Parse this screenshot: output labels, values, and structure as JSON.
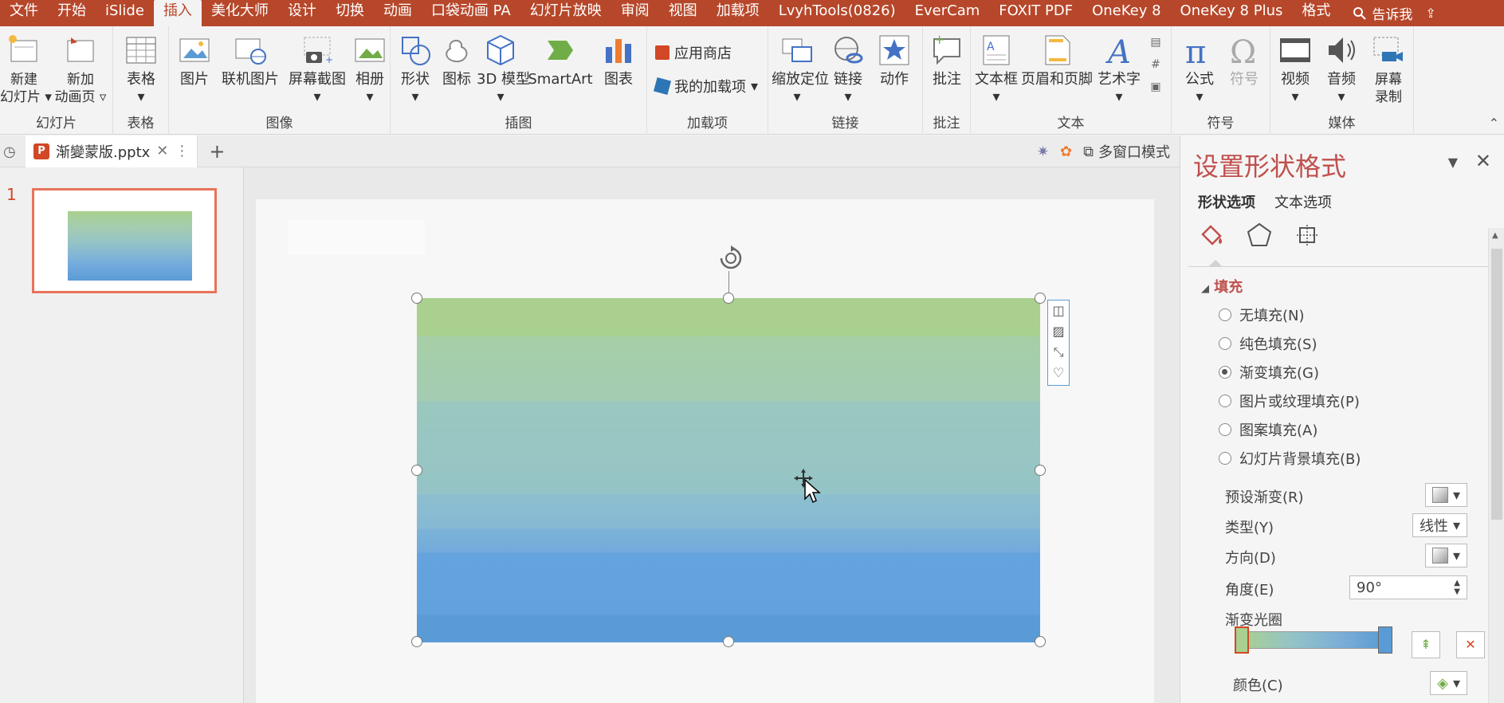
{
  "menu": {
    "tabs": [
      "文件",
      "开始",
      "iSlide",
      "插入",
      "美化大师",
      "设计",
      "切换",
      "动画",
      "口袋动画 PA",
      "幻灯片放映",
      "审阅",
      "视图",
      "加载项",
      "LvyhTools(0826)",
      "EverCam",
      "FOXIT PDF",
      "OneKey 8",
      "OneKey 8 Plus",
      "格式"
    ],
    "active_index": 3,
    "tell_me": "告诉我"
  },
  "ribbon": {
    "slides_group": {
      "label": "幻灯片",
      "new_slide": "新建\n幻灯片",
      "new_anim": "新加\n动画页"
    },
    "table_group": {
      "label": "表格",
      "table": "表格"
    },
    "image_group": {
      "label": "图像",
      "picture": "图片",
      "online_picture": "联机图片",
      "screenshot": "屏幕截图",
      "album": "相册"
    },
    "illust_group": {
      "label": "插图",
      "shapes": "形状",
      "icons": "图标",
      "model3d": "3D 模型",
      "smartart": "SmartArt",
      "chart": "图表"
    },
    "addins_group": {
      "label": "加载项",
      "store": "应用商店",
      "my_addins": "我的加载项"
    },
    "links_group": {
      "label": "链接",
      "zoom": "缩放定位",
      "link": "链接",
      "action": "动作"
    },
    "comments_group": {
      "label": "批注",
      "comment": "批注"
    },
    "text_group": {
      "label": "文本",
      "textbox": "文本框",
      "header_footer": "页眉和页脚",
      "wordart": "艺术字"
    },
    "symbols_group": {
      "label": "符号",
      "equation": "公式",
      "symbol": "符号"
    },
    "media_group": {
      "label": "媒体",
      "video": "视频",
      "audio": "音频",
      "record": "屏幕\n录制"
    }
  },
  "tabbar": {
    "doc_name": "渐變蒙版.pptx",
    "multi_window": "多窗口模式"
  },
  "thumbs": {
    "slide_number": "1"
  },
  "pane": {
    "title": "设置形状格式",
    "tab_shape": "形状选项",
    "tab_text": "文本选项",
    "fill_section": "填充",
    "fill_options": [
      "无填充(N)",
      "纯色填充(S)",
      "渐变填充(G)",
      "图片或纹理填充(P)",
      "图案填充(A)",
      "幻灯片背景填充(B)"
    ],
    "fill_selected": 2,
    "preset_label": "预设渐变(R)",
    "type_label": "类型(Y)",
    "type_value": "线性",
    "direction_label": "方向(D)",
    "angle_label": "角度(E)",
    "angle_value": "90°",
    "stops_label": "渐变光圈",
    "color_label": "颜色(C)"
  },
  "colors": {
    "accent": "#b7472a",
    "gradient_top": "#a9d08e",
    "gradient_bottom": "#5b9bd5"
  }
}
